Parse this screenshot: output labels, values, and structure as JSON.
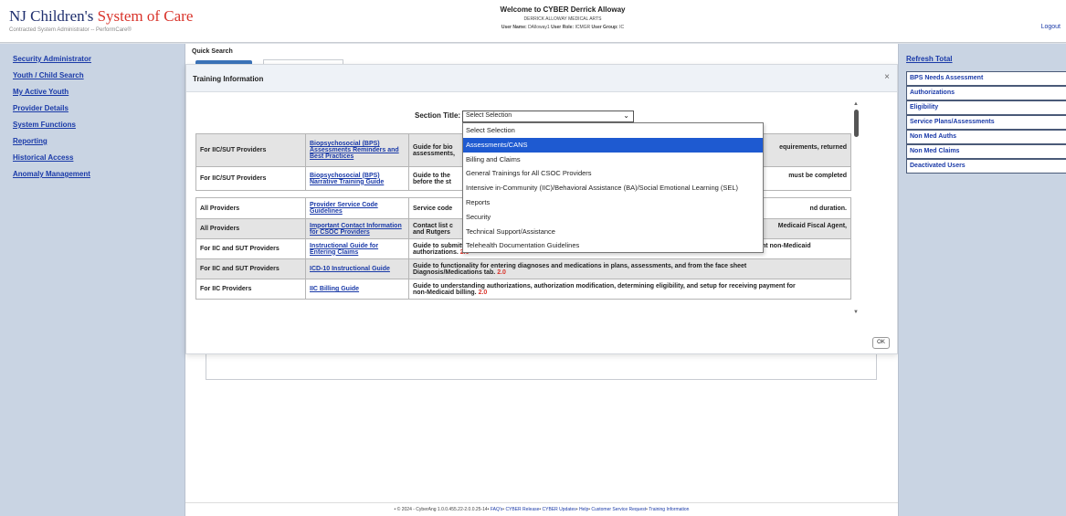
{
  "header": {
    "logo_main": "NJ Children's",
    "logo_accent": "System of Care",
    "logo_sub": "Contracted System Administrator -- PerformCare®",
    "welcome": "Welcome to CYBER Derrick Alloway",
    "org": "DERRICK ALLOWAY MEDICAL ARTS",
    "user_name_label": "User Name:",
    "user_name": "DAlloway1",
    "user_role_label": "User Role:",
    "user_role": "ICMGR",
    "user_group_label": "User Group:",
    "user_group": "IC",
    "logout": "Logout"
  },
  "left_nav": [
    "Security Administrator",
    "Youth / Child Search",
    "My Active Youth",
    "Provider Details",
    "System Functions",
    "Reporting",
    "Historical Access",
    "Anomaly Management"
  ],
  "quick_search": {
    "label": "Quick Search"
  },
  "modal": {
    "title": "Training Information",
    "close": "×",
    "section_label": "Section Title:",
    "section_value": "Select Selection",
    "ok": "OK",
    "rows": [
      {
        "who": "For IIC/SUT Providers",
        "doc": "Biopsychosocial (BPS) Assessments Reminders and Best Practices",
        "desc": "Guide for bio",
        "desc_tail": "equirements, returned",
        "desc2": "assessments,",
        "gray": true
      },
      {
        "who": "For IIC/SUT Providers",
        "doc": "Biopsychosocial (BPS) Narrative Training Guide",
        "desc": "Guide to the",
        "desc_tail": "must be completed",
        "desc2": "before the st",
        "gray": false
      },
      {
        "who": "All Providers",
        "doc": "Provider Service Code Guidelines",
        "desc": "Service code",
        "desc_tail": "nd duration.",
        "desc2": "",
        "gray": false
      },
      {
        "who": "All Providers",
        "doc": "Important Contact Information for CSOC Providers",
        "desc": "Contact list c",
        "desc_tail": "Medicaid Fiscal Agent,",
        "desc2": "and Rutgers",
        "gray": true
      },
      {
        "who": "For IIC and SUT Providers",
        "doc": "Instructional Guide for Entering Claims",
        "desc": "Guide to submitting claims using the Health Insurance Claim Form in CYBER for biopsychosocial needs assessment non-Medicaid",
        "desc_tail": "",
        "desc2": "authorizations.",
        "ver": "2.0",
        "gray": false
      },
      {
        "who": "For IIC and SUT Providers",
        "doc": "ICD-10 Instructional Guide",
        "desc": "Guide to functionality for entering diagnoses and medications in plans, assessments, and from the face sheet",
        "desc_tail": "",
        "desc2": "Diagnosis/Medications tab.",
        "ver": "2.0",
        "gray": true
      },
      {
        "who": "For IIC Providers",
        "doc": "IIC Billing Guide",
        "desc": "Guide to understanding authorizations, authorization modification, determining eligibility, and setup for receiving payment for",
        "desc_tail": "",
        "desc2": "non-Medicaid billing.",
        "ver": "2.0",
        "gray": false
      }
    ]
  },
  "dropdown": {
    "options": [
      "Select Selection",
      "Assessments/CANS",
      "Billing and Claims",
      "General Trainings for All CSOC Providers",
      "Intensive in-Community (IIC)/Behavioral Assistance (BA)/Social Emotional Learning (SEL)",
      "Reports",
      "Security",
      "Technical Support/Assistance",
      "Telehealth Documentation Guidelines"
    ],
    "selected_index": 1
  },
  "right_nav": {
    "refresh": "Refresh Total",
    "items": [
      "BPS Needs Assessment",
      "Authorizations",
      "Eligibility",
      "Service Plans/Assessments",
      "Non Med Auths",
      "Non Med Claims",
      "Deactivated Users"
    ]
  },
  "footer": {
    "copyright": "© 2024 - CyberAng 1.0.0.455.22-2.0.0.25-14",
    "links": [
      "FAQ's",
      "CYBER Release",
      "CYBER Updates",
      "Help",
      "Customer Service Request",
      "Training Information"
    ]
  },
  "icons": {
    "close": "close-icon",
    "chevron": "chevron-down-icon",
    "scroll_up": "scroll-up-icon",
    "scroll_down": "scroll-down-icon"
  },
  "colors": {
    "accent_red": "#d9342b",
    "link_blue": "#1a3aa8",
    "selected_blue": "#1e5ad1",
    "sidebar": "#c9d4e3"
  }
}
